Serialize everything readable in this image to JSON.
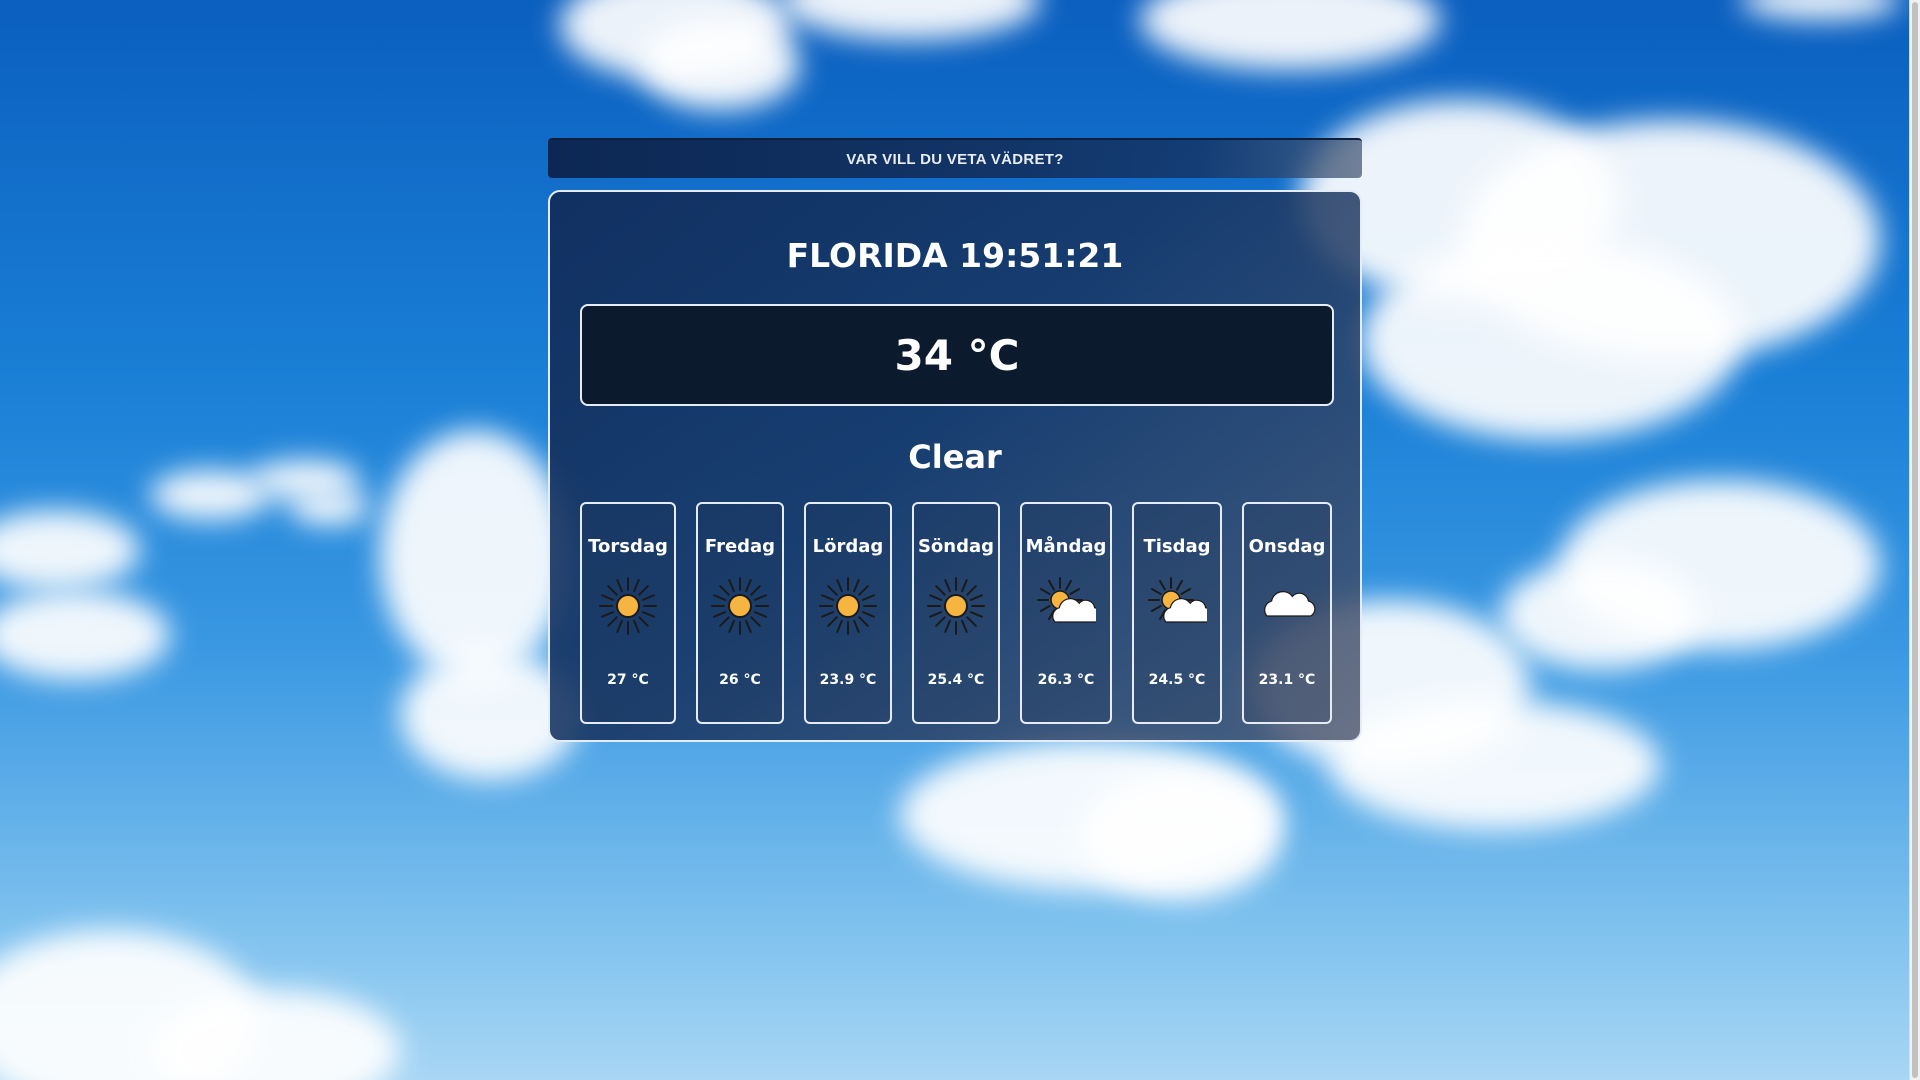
{
  "search": {
    "label": "VAR VILL DU VETA VÄDRET?"
  },
  "current": {
    "location_time": "FLORIDA 19:51:21",
    "temperature": "34 °C",
    "condition": "Clear"
  },
  "forecast": [
    {
      "day": "Torsdag",
      "temp": "27 °C",
      "icon": "sun-icon"
    },
    {
      "day": "Fredag",
      "temp": "26 °C",
      "icon": "sun-icon"
    },
    {
      "day": "Lördag",
      "temp": "23.9 °C",
      "icon": "sun-icon"
    },
    {
      "day": "Söndag",
      "temp": "25.4 °C",
      "icon": "sun-icon"
    },
    {
      "day": "Måndag",
      "temp": "26.3 °C",
      "icon": "partly-cloudy-icon"
    },
    {
      "day": "Tisdag",
      "temp": "24.5 °C",
      "icon": "partly-cloudy-icon"
    },
    {
      "day": "Onsdag",
      "temp": "23.1 °C",
      "icon": "cloud-icon"
    }
  ],
  "colors": {
    "sun": "#f6b540",
    "sun_outline": "#1a1a1a",
    "cloud": "#ffffff",
    "cloud_outline": "#1a1a1a"
  }
}
